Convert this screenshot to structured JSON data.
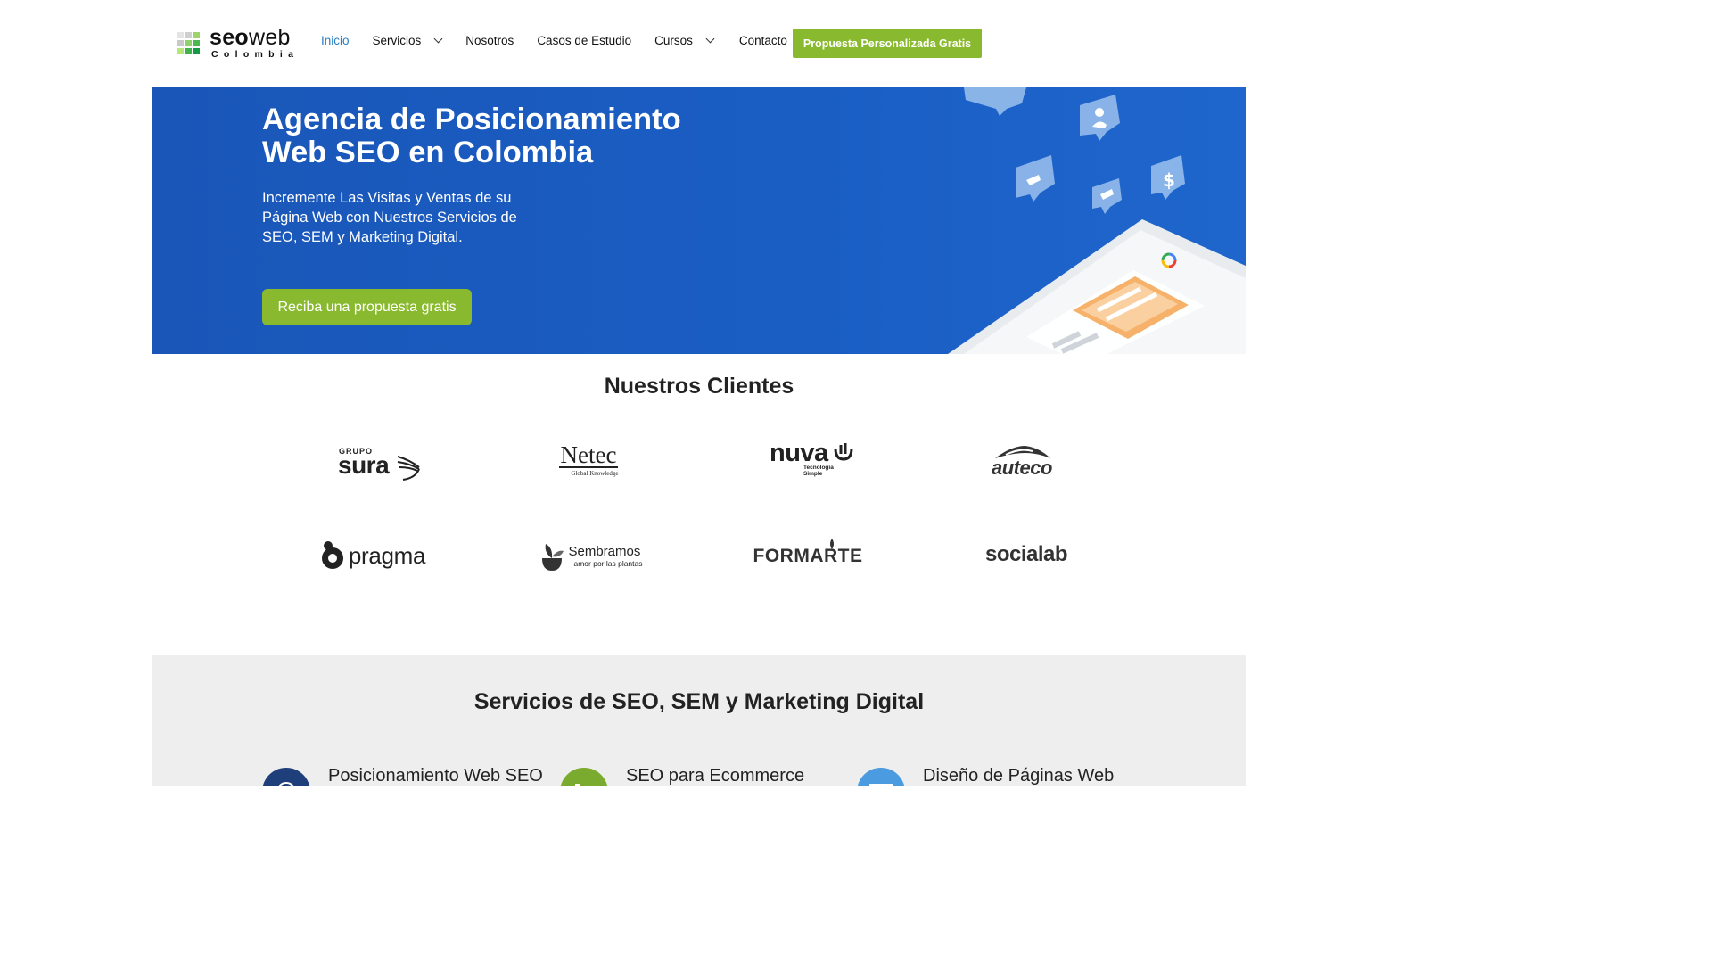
{
  "header": {
    "logo": {
      "main_bold": "seo",
      "main_light": "web",
      "sub": "Colombia"
    },
    "nav": [
      {
        "label": "Inicio",
        "active": true,
        "dropdown": false
      },
      {
        "label": "Servicios",
        "active": false,
        "dropdown": true
      },
      {
        "label": "Nosotros",
        "active": false,
        "dropdown": false
      },
      {
        "label": "Casos de Estudio",
        "active": false,
        "dropdown": false
      },
      {
        "label": "Cursos",
        "active": false,
        "dropdown": true
      },
      {
        "label": "Contacto",
        "active": false,
        "dropdown": false
      }
    ],
    "cta_label": "Propuesta Personalizada Gratis"
  },
  "hero": {
    "title": "Agencia de Posicionamiento Web SEO en Colombia",
    "subtitle": "Incremente Las Visitas y Ventas de su Página Web con Nuestros Servicios de SEO, SEM y Marketing Digital.",
    "button_label": "Reciba una propuesta gratis"
  },
  "clients": {
    "title": "Nuestros Clientes",
    "logos": [
      {
        "name": "sura",
        "label": "sura",
        "prefix": "GRUPO"
      },
      {
        "name": "netec",
        "label": "Netec",
        "tagline": "Global Knowledge"
      },
      {
        "name": "nuva",
        "label": "nuva",
        "tagline": "Tecnología Simple"
      },
      {
        "name": "auteco",
        "label": "auteco"
      },
      {
        "name": "pragma",
        "label": "pragma"
      },
      {
        "name": "sembramos",
        "label": "Sembramos",
        "tagline": "amor por las plantas"
      },
      {
        "name": "formarte",
        "label": "FORMARTE"
      },
      {
        "name": "socialab",
        "label": "socialab"
      }
    ]
  },
  "services": {
    "title": "Servicios de SEO, SEM y Marketing Digital",
    "items": [
      {
        "label": "Posicionamiento Web SEO",
        "color": "#1e3f7a"
      },
      {
        "label": "SEO para Ecommerce",
        "color": "#7aab2e"
      },
      {
        "label": "Diseño de Páginas Web",
        "color": "#4a9be0"
      }
    ]
  },
  "colors": {
    "accent_green": "#89b92e",
    "hero_blue": "#1a5ec4",
    "nav_active": "#2a7fc4"
  }
}
